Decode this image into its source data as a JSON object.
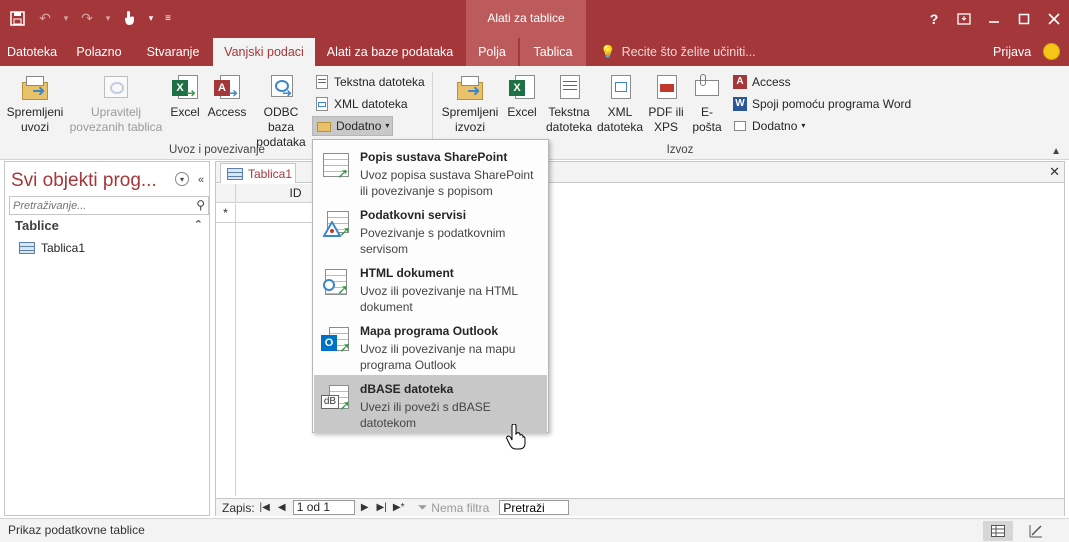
{
  "titlebar": {
    "contextual_title": "Alati za tablice",
    "help": "?",
    "quick_access": [
      "save-icon",
      "undo-icon",
      "redo-icon",
      "touch-mode-icon",
      "customize-icon"
    ]
  },
  "tabs": [
    {
      "label": "Datoteka"
    },
    {
      "label": "Polazno"
    },
    {
      "label": "Stvaranje"
    },
    {
      "label": "Vanjski podaci"
    },
    {
      "label": "Alati za baze podataka"
    },
    {
      "label": "Polja"
    },
    {
      "label": "Tablica"
    }
  ],
  "tellme": "Recite što želite učiniti...",
  "account": {
    "signin": "Prijava"
  },
  "ribbon": {
    "import": {
      "group_label": "Uvoz i povezivanje",
      "saved_imports": "Spremljeni uvozi",
      "linked_manager": "Upravitelj povezanih tablica",
      "excel": "Excel",
      "access": "Access",
      "odbc": "ODBC baza podataka",
      "text_file": "Tekstna datoteka",
      "xml_file": "XML datoteka",
      "more": "Dodatno"
    },
    "export": {
      "group_label": "Izvoz",
      "saved_exports": "Spremljeni izvozi",
      "excel": "Excel",
      "text_file": "Tekstna datoteka",
      "xml_file": "XML datoteka",
      "pdf_xps": "PDF ili XPS",
      "email": "E-pošta",
      "access": "Access",
      "word_merge": "Spoji pomoću programa Word",
      "more": "Dodatno"
    }
  },
  "navpane": {
    "title": "Svi objekti prog...",
    "search_placeholder": "Pretraživanje...",
    "group": "Tablice",
    "items": [
      {
        "label": "Tablica1"
      }
    ]
  },
  "document": {
    "tab": "Tablica1",
    "column_header": "ID",
    "new_row_marker": "*",
    "new_row_value": "(No",
    "record_nav": {
      "label": "Zapis:",
      "current": "1 od 1",
      "filter": "Nema filtra",
      "search": "Pretraži"
    }
  },
  "dropdown": {
    "items": [
      {
        "title": "Popis sustava SharePoint",
        "desc": "Uvoz popisa sustava SharePoint ili povezivanje s popisom",
        "icon": "sharepoint-list-icon"
      },
      {
        "title": "Podatkovni servisi",
        "desc": "Povezivanje s podatkovnim servisom",
        "icon": "data-services-icon"
      },
      {
        "title": "HTML dokument",
        "desc": "Uvoz ili povezivanje na HTML dokument",
        "icon": "html-document-icon"
      },
      {
        "title": "Mapa programa Outlook",
        "desc": "Uvoz ili povezivanje na mapu programa Outlook",
        "icon": "outlook-folder-icon"
      },
      {
        "title": "dBASE datoteka",
        "desc": "Uvezi ili poveži s dBASE datotekom",
        "icon": "dbase-file-icon"
      }
    ],
    "hovered_index": 4
  },
  "statusbar": {
    "text": "Prikaz podatkovne tablice"
  },
  "colors": {
    "accent": "#a4373a",
    "contextual": "#bd5a5c",
    "ribbon_bg": "#f3f3f3",
    "hover": "#c8c8c8"
  }
}
